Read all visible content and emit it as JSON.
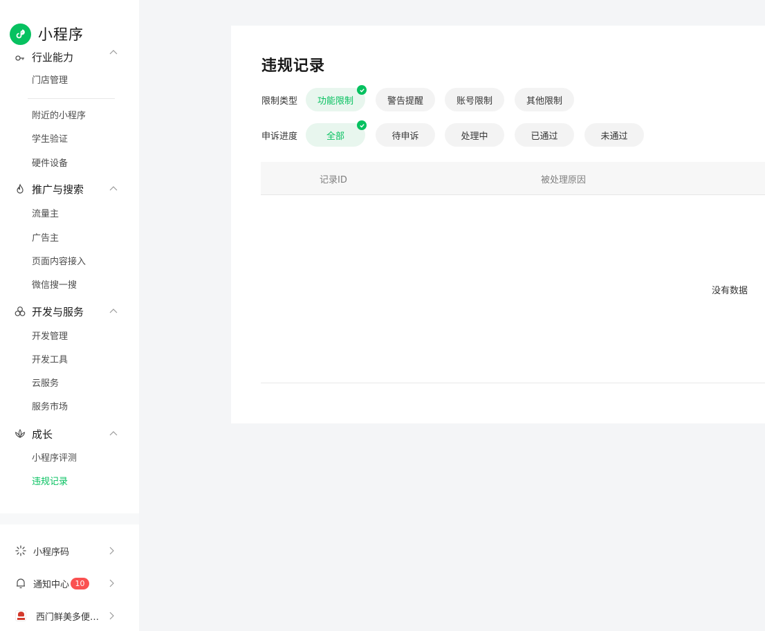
{
  "app": {
    "title": "小程序",
    "brand_color": "#07c160"
  },
  "sidebar": {
    "sections": [
      {
        "title": "行业能力",
        "icon": "key-icon",
        "items": [
          "门店管理",
          "附近的小程序",
          "学生验证",
          "硬件设备"
        ]
      },
      {
        "title": "推广与搜索",
        "icon": "flame-icon",
        "items": [
          "流量主",
          "广告主",
          "页面内容接入",
          "微信搜一搜"
        ]
      },
      {
        "title": "开发与服务",
        "icon": "circles-icon",
        "items": [
          "开发管理",
          "开发工具",
          "云服务",
          "服务市场"
        ]
      },
      {
        "title": "成长",
        "icon": "lotus-icon",
        "items": [
          "小程序评测",
          "违规记录"
        ]
      }
    ],
    "active_item": "违规记录",
    "footer": [
      {
        "label": "小程序码",
        "icon": "qrcode-icon"
      },
      {
        "label": "通知中心",
        "icon": "bell-icon",
        "badge": "10"
      },
      {
        "label": "西门鲜美多便…",
        "icon": "account-avatar"
      }
    ]
  },
  "main": {
    "title": "违规记录",
    "filters": {
      "restriction_type": {
        "label": "限制类型",
        "options": [
          "功能限制",
          "警告提醒",
          "账号限制",
          "其他限制"
        ],
        "selected": "功能限制"
      },
      "appeal_progress": {
        "label": "申诉进度",
        "options": [
          "全部",
          "待申诉",
          "处理中",
          "已通过",
          "未通过"
        ],
        "selected": "全部"
      }
    },
    "table": {
      "columns": [
        "记录ID",
        "被处理原因"
      ],
      "empty_text": "没有数据"
    }
  }
}
